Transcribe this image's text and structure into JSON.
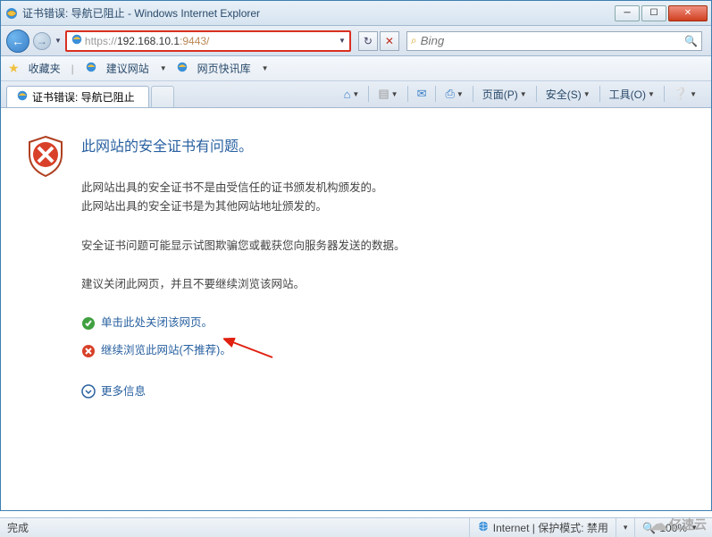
{
  "window": {
    "title": "证书错误: 导航已阻止 - Windows Internet Explorer"
  },
  "address": {
    "protocol": "https://",
    "host": "192.168.10.1",
    "port": ":9443/",
    "full": "https://192.168.10.1:9443/"
  },
  "search": {
    "placeholder": "Bing"
  },
  "favbar": {
    "label": "收藏夹",
    "suggested": "建议网站",
    "quick": "网页快讯库"
  },
  "tab": {
    "title": "证书错误: 导航已阻止"
  },
  "cmd": {
    "page": "页面(P)",
    "safety": "安全(S)",
    "tools": "工具(O)"
  },
  "cert": {
    "heading": "此网站的安全证书有问题。",
    "line1": "此网站出具的安全证书不是由受信任的证书颁发机构颁发的。",
    "line2": "此网站出具的安全证书是为其他网站地址颁发的。",
    "line3": "安全证书问题可能显示试图欺骗您或截获您向服务器发送的数据。",
    "line4": "建议关闭此网页，并且不要继续浏览该网站。",
    "close_link": "单击此处关闭该网页。",
    "continue_link": "继续浏览此网站(不推荐)。",
    "more": "更多信息"
  },
  "status": {
    "done": "完成",
    "zone": "Internet | 保护模式: 禁用",
    "zoom": "100%"
  },
  "watermark": "亿速云"
}
